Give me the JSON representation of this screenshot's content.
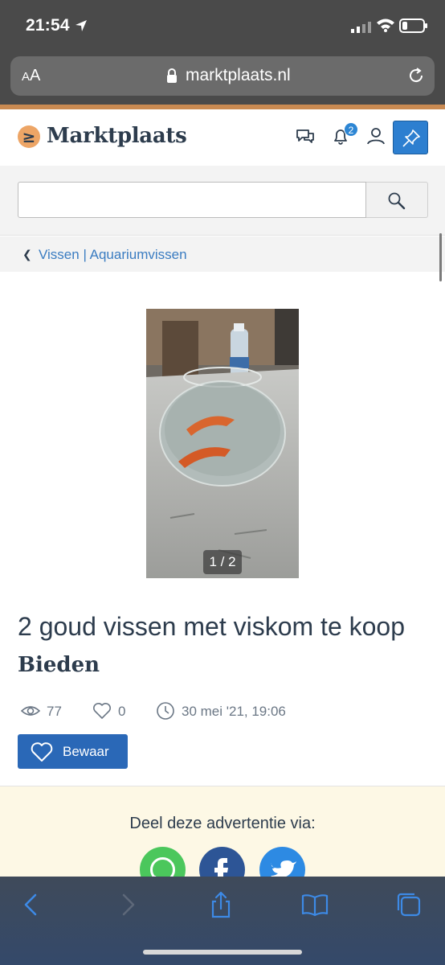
{
  "status_bar": {
    "time": "21:54"
  },
  "browser": {
    "aa_label_small": "A",
    "aa_label": "A",
    "url": "marktplaats.nl"
  },
  "site": {
    "logo_text": "Marktplaats",
    "logo_mark": "≥",
    "notification_count": "2"
  },
  "search": {
    "placeholder": ""
  },
  "breadcrumb": {
    "label": "Vissen | Aquariumvissen"
  },
  "listing": {
    "photo_counter": "1 / 2",
    "title": "2 goud vissen met viskom te koop",
    "price": "Bieden",
    "views": "77",
    "favorites": "0",
    "posted": "30 mei '21, 19:06",
    "save_label": "Bewaar"
  },
  "share": {
    "label": "Deel deze advertentie via:"
  },
  "colors": {
    "brand_blue": "#2a68b7",
    "link_blue": "#3a7cc1",
    "logo_orange": "#eda566",
    "share_bg": "#fdf8e5"
  }
}
